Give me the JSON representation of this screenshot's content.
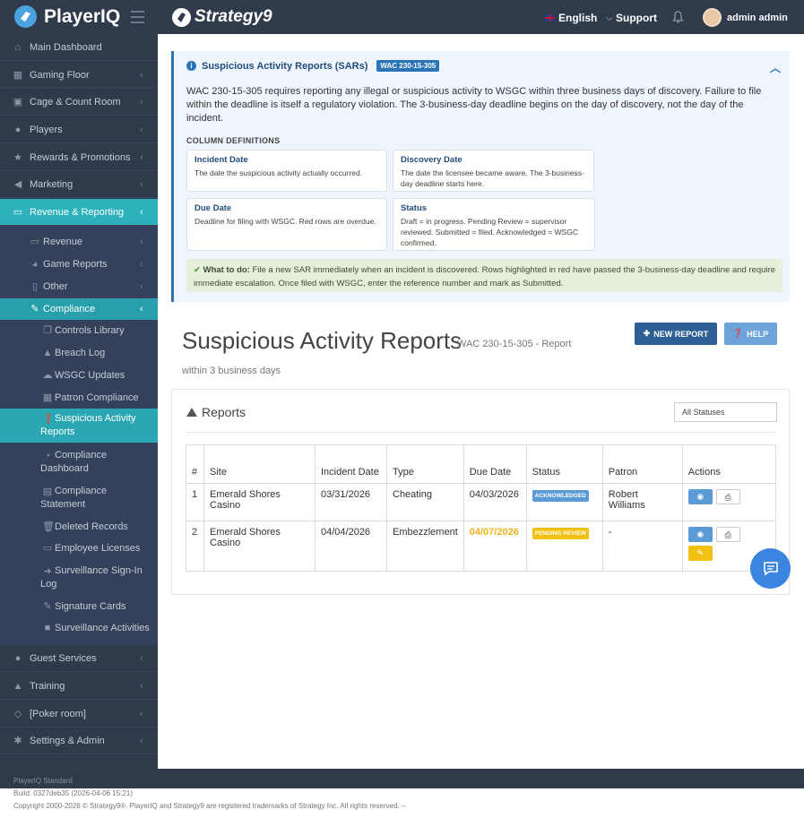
{
  "topbar": {
    "app_name": "PlayerIQ",
    "brand": "Strategy9",
    "language": "English",
    "support": "Support",
    "user": "admin admin"
  },
  "sidebar": {
    "main_top": [
      {
        "label": "Main Dashboard",
        "icon": "home-icon"
      },
      {
        "label": "Gaming Floor",
        "icon": "table-icon"
      },
      {
        "label": "Cage & Count Room",
        "icon": "lock-icon"
      },
      {
        "label": "Players",
        "icon": "user-icon"
      },
      {
        "label": "Rewards & Promotions",
        "icon": "star-icon"
      },
      {
        "label": "Marketing",
        "icon": "bullhorn-icon"
      },
      {
        "label": "Revenue & Reporting",
        "icon": "money-icon"
      }
    ],
    "sub": [
      {
        "label": "Revenue",
        "icon": "money-icon"
      },
      {
        "label": "Game Reports",
        "icon": "pie-chart-icon"
      },
      {
        "label": "Other",
        "icon": "file-icon"
      },
      {
        "label": "Compliance",
        "icon": "gavel-icon"
      }
    ],
    "compliance": [
      {
        "label": "Controls Library",
        "icon": "copy-icon"
      },
      {
        "label": "Breach Log",
        "icon": "warning-icon"
      },
      {
        "label": "WSGC Updates",
        "icon": "cloud-download-icon"
      },
      {
        "label": "Patron Compliance",
        "icon": "table-icon"
      },
      {
        "label_1": "Suspicious Activity",
        "label_2": "Reports",
        "icon": "exclamation-circle-icon"
      },
      {
        "label_1": "Compliance",
        "label_2": "Dashboard",
        "icon": "dashboard-icon"
      },
      {
        "label_1": "Compliance",
        "label_2": "Statement",
        "icon": "file-text-icon"
      },
      {
        "label": "Deleted Records",
        "icon": "trash-icon"
      },
      {
        "label": "Employee Licenses",
        "icon": "id-card-icon"
      },
      {
        "label_1": "Surveillance Sign-In",
        "label_2": "Log",
        "icon": "sign-in-icon"
      },
      {
        "label": "Signature Cards",
        "icon": "pencil-icon"
      },
      {
        "label": "Surveillance Activities",
        "icon": "video-camera-icon"
      }
    ],
    "main_bottom": [
      {
        "label": "Guest Services",
        "icon": "users-icon"
      },
      {
        "label": "Training",
        "icon": "graduation-cap-icon"
      },
      {
        "label": "[Poker room]",
        "icon": "diamond-icon"
      },
      {
        "label": "Settings & Admin",
        "icon": "wrench-icon"
      }
    ]
  },
  "info": {
    "title": "Suspicious Activity Reports (SARs)",
    "tag": "WAC 230-15-305",
    "paragraph": "WAC 230-15-305 requires reporting any illegal or suspicious activity to WSGC within three business days of discovery. Failure to file within the deadline is itself a regulatory violation. The 3-business-day deadline begins on the day of discovery, not the day of the incident.",
    "col_def_title": "COLUMN DEFINITIONS",
    "definitions": [
      {
        "term": "Incident Date",
        "desc": "The date the suspicious activity actually occurred."
      },
      {
        "term": "Discovery Date",
        "desc": "The date the licensee became aware. The 3-business-day deadline starts here."
      },
      {
        "term": "Due Date",
        "desc": "Deadline for filing with WSGC. Red rows are overdue."
      },
      {
        "term": "Status",
        "desc": "Draft = in progress. Pending Review = supervisor reviewed. Submitted = filed. Acknowledged = WSGC confirmed."
      }
    ],
    "todo_label": "What to do:",
    "todo_text": " File a new SAR immediately when an incident is discovered. Rows highlighted in red have passed the 3-business-day deadline and require immediate escalation. Once filed with WSGC, enter the reference number and mark as Submitted."
  },
  "page": {
    "title": "Suspicious Activity Reports",
    "subtitle_a": "WAC 230-15-305 - Report",
    "subtitle_b": "within 3 business days",
    "new_report": "NEW REPORT",
    "help": "HELP"
  },
  "reports": {
    "title": "Reports",
    "filter": "All Statuses",
    "columns": [
      "#",
      "Site",
      "Incident Date",
      "Type",
      "Due Date",
      "Status",
      "Patron",
      "Actions"
    ],
    "rows": [
      {
        "num": "1",
        "site": "Emerald Shores Casino",
        "incident": "03/31/2026",
        "type": "Cheating",
        "due": "04/03/2026",
        "status": "ACKNOWLEDGED",
        "patron": "Robert Williams"
      },
      {
        "num": "2",
        "site": "Emerald Shores Casino",
        "incident": "04/04/2026",
        "type": "Embezzlement",
        "due": "04/07/2026",
        "status": "PENDING REVIEW",
        "patron": "-"
      }
    ]
  },
  "footer": {
    "edition": "PlayerIQ Standard",
    "build": "Build: 0327deb35 (2026-04-06 15:21)",
    "copyright": "Copyright 2000-2026 © Strategy9®. PlayerIQ and Strategy9 are registered trademarks of Strategy Inc. All rights reserved. --"
  },
  "colors": {
    "sidebar": "#2f3a4b",
    "accent": "#2cb1bd",
    "primary": "#2c5f93"
  }
}
